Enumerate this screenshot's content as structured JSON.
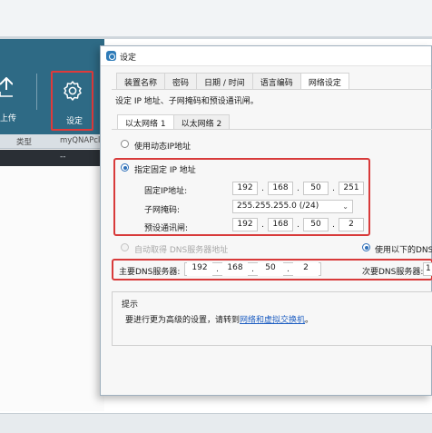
{
  "app": {
    "toolbar": {
      "upload_label": "上传",
      "settings_label": "设定"
    },
    "columns": [
      "类型",
      "myQNAPcl"
    ],
    "row_value": "--"
  },
  "dialog": {
    "title": "设定",
    "tabs": [
      "装置名称",
      "密码",
      "日期 / 时间",
      "语言编码",
      "网络设定"
    ],
    "active_tab": "网络设定",
    "section_caption": "设定 IP 地址、子网掩码和预设通讯闸。",
    "subtabs": [
      "以太网络 1",
      "以太网络 2"
    ],
    "dhcp_label": "使用动态IP地址",
    "static_label": "指定固定 IP 地址",
    "ip_label": "固定IP地址:",
    "ip": [
      "192",
      "168",
      "50",
      "251"
    ],
    "mask_label": "子网掩码:",
    "mask": "255.255.255.0 (/24)",
    "gateway_label": "预设通讯闸:",
    "gateway": [
      "192",
      "168",
      "50",
      "2"
    ],
    "dns_auto_label": "自动取得 DNS服务器地址",
    "dns_manual_label": "使用以下的DNS",
    "primary_dns_label": "主要DNS服务器:",
    "primary_dns": [
      "192",
      "168",
      "50",
      "2"
    ],
    "secondary_dns_label": "次要DNS服务器:",
    "secondary_dns_value": "1",
    "hint_title": "提示",
    "hint_text": "要进行更为高级的设置，请转到",
    "hint_link": "网络和虚拟交换机",
    "hint_end": "。"
  },
  "colors": {
    "toolbar": "#2e6a85",
    "highlight": "#d83a3a",
    "link": "#1f5fc2"
  }
}
